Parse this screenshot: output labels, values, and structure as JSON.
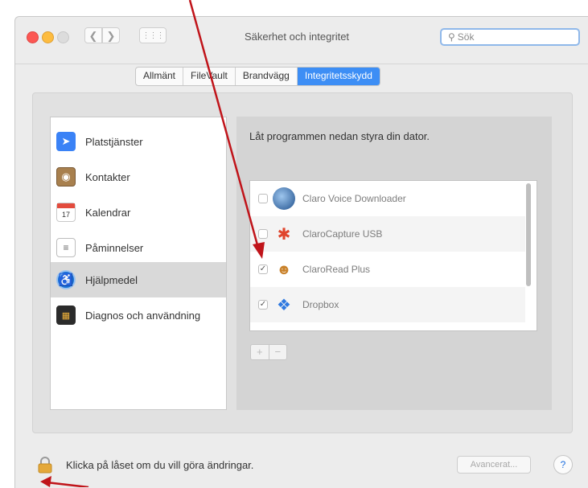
{
  "window": {
    "title": "Säkerhet och integritet",
    "search_placeholder": "Sök",
    "grid_icon": "grid-icon",
    "back_icon": "chevron-left-icon",
    "forward_icon": "chevron-right-icon"
  },
  "tabs": [
    {
      "label": "Allmänt",
      "active": false
    },
    {
      "label": "FileVault",
      "active": false
    },
    {
      "label": "Brandvägg",
      "active": false
    },
    {
      "label": "Integritetsskydd",
      "active": true
    }
  ],
  "sidebar": {
    "items": [
      {
        "label": "Platstjänster",
        "icon": "location-arrow-icon",
        "selected": false
      },
      {
        "label": "Kontakter",
        "icon": "contacts-book-icon",
        "selected": false
      },
      {
        "label": "Kalendrar",
        "icon": "calendar-icon",
        "selected": false
      },
      {
        "label": "Påminnelser",
        "icon": "reminders-list-icon",
        "selected": false
      },
      {
        "label": "Hjälpmedel",
        "icon": "accessibility-icon",
        "selected": true
      },
      {
        "label": "Diagnos och användning",
        "icon": "diagnostics-icon",
        "selected": false
      }
    ]
  },
  "content": {
    "description": "Låt programmen nedan styra din dator.",
    "apps": [
      {
        "name": "Claro Voice Downloader",
        "checked": false,
        "icon": "claro-voice-downloader-icon"
      },
      {
        "name": "ClaroCapture USB",
        "checked": false,
        "icon": "clarocapture-icon"
      },
      {
        "name": "ClaroRead Plus",
        "checked": true,
        "icon": "claroread-icon"
      },
      {
        "name": "Dropbox",
        "checked": true,
        "icon": "dropbox-icon"
      }
    ],
    "add_label": "+",
    "remove_label": "−"
  },
  "footer": {
    "lock_message": "Klicka på låset om du vill göra ändringar.",
    "advanced_label": "Avancerat...",
    "help_label": "?"
  },
  "colors": {
    "accent": "#3d8ef5",
    "annotation_arrow": "#c0141a"
  }
}
